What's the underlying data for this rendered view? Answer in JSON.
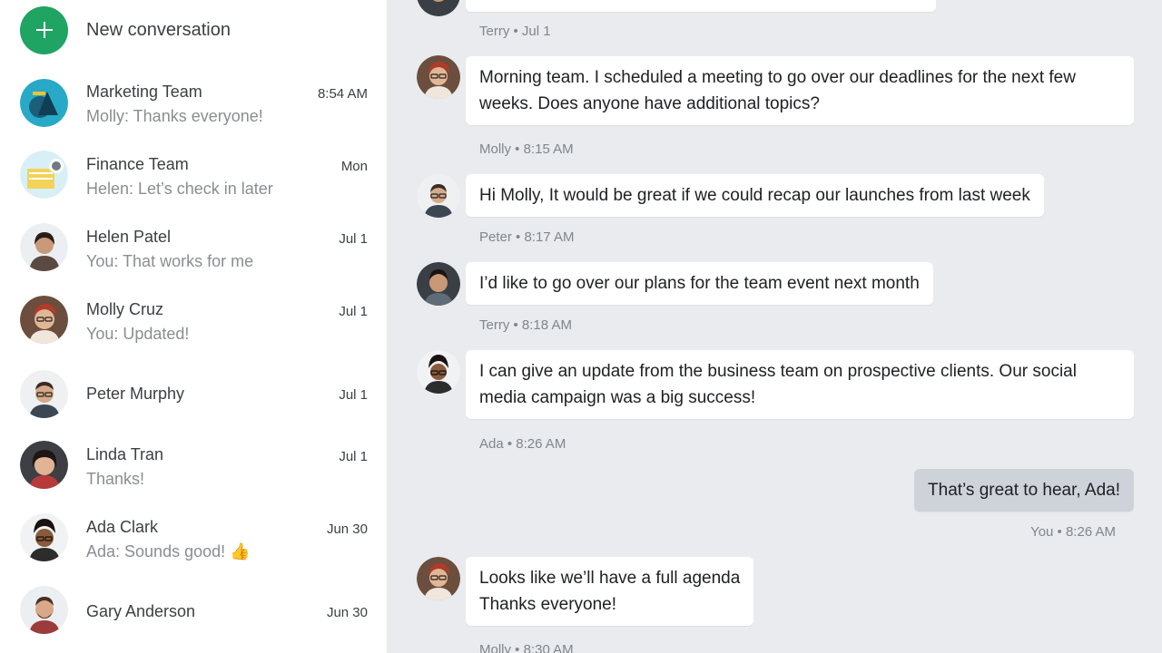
{
  "sidebar": {
    "new_conversation_label": "New conversation",
    "conversations": [
      {
        "name": "Marketing Team",
        "preview": "Molly: Thanks everyone!",
        "time": "8:54 AM"
      },
      {
        "name": "Finance Team",
        "preview": "Helen: Let’s check in later",
        "time": "Mon"
      },
      {
        "name": "Helen Patel",
        "preview": "You: That works for me",
        "time": "Jul 1"
      },
      {
        "name": "Molly Cruz",
        "preview": "You: Updated!",
        "time": "Jul 1"
      },
      {
        "name": "Peter Murphy",
        "preview": "",
        "time": "Jul 1"
      },
      {
        "name": "Linda Tran",
        "preview": "Thanks!",
        "time": "Jul 1"
      },
      {
        "name": "Ada Clark",
        "preview": "Ada: Sounds good! 👍",
        "time": "Jun 30"
      },
      {
        "name": "Gary Anderson",
        "preview": "",
        "time": "Jun 30"
      }
    ]
  },
  "chat": {
    "messages": [
      {
        "meta": "Terry • Jul 1"
      },
      {
        "text": "Morning team. I scheduled a meeting to go over our deadlines for the next few weeks. Does anyone have additional topics?",
        "meta": "Molly • 8:15 AM"
      },
      {
        "text": "Hi Molly, It would be great if we could recap our launches from last week",
        "meta": "Peter • 8:17 AM"
      },
      {
        "text": "I’d like to go over our plans for the team event next month",
        "meta": "Terry • 8:18 AM"
      },
      {
        "text": "I can give an update from the business team on prospective clients. Our social media campaign was a big success!",
        "meta": "Ada • 8:26 AM"
      },
      {
        "text": "That’s great to hear, Ada!",
        "meta": "You • 8:26 AM"
      },
      {
        "text": "Looks like we’ll have a full agenda\nThanks everyone!",
        "meta": "Molly • 8:30 AM"
      }
    ]
  },
  "colors": {
    "accent_green": "#1fa463",
    "chat_background": "#e9ebee",
    "own_bubble": "#cdd3d9"
  }
}
